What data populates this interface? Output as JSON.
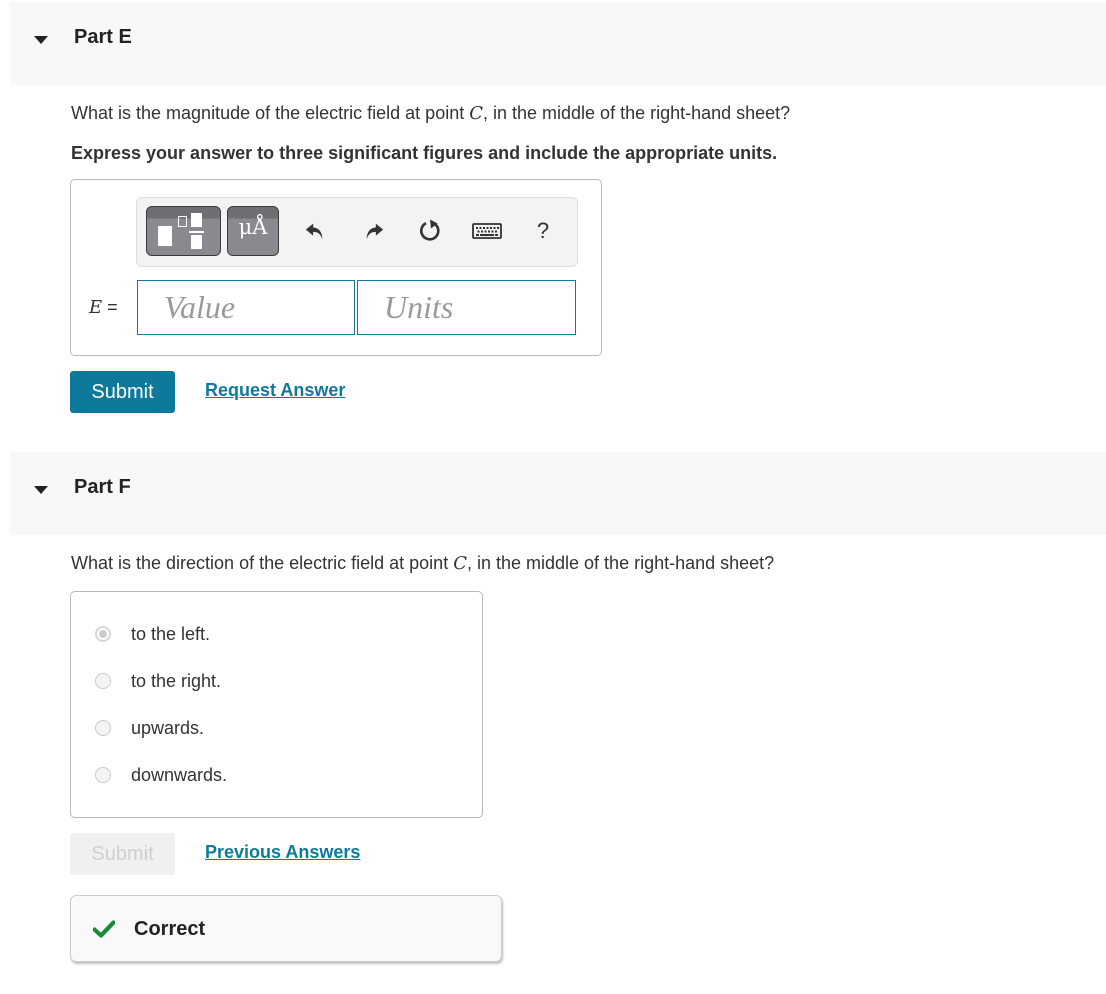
{
  "colors": {
    "accent": "#0d7a9b",
    "header_bg": "#f8f8f8",
    "correct_green": "#1a8a3a"
  },
  "part_e": {
    "title": "Part E",
    "question_before": "What is the magnitude of the electric field at point ",
    "question_var": "C",
    "question_after": ", in the middle of the right-hand sheet?",
    "instruction": "Express your answer to three significant figures and include the appropriate units.",
    "toolbar": {
      "templates_icon": "templates-icon",
      "units_label": "μÅ",
      "undo_icon": "undo-icon",
      "redo_icon": "redo-icon",
      "reset_icon": "reset-icon",
      "keyboard_icon": "keyboard-icon",
      "help_label": "?"
    },
    "equation_var": "E",
    "equation_sign": " =",
    "value_field": {
      "value": "",
      "placeholder": "Value"
    },
    "units_field": {
      "value": "",
      "placeholder": "Units"
    },
    "submit_label": "Submit",
    "request_answer_label": "Request Answer"
  },
  "part_f": {
    "title": "Part F",
    "question_before": "What is the direction of the electric field at point ",
    "question_var": "C",
    "question_after": ", in the middle of the right-hand sheet?",
    "options": [
      {
        "label": "to the left.",
        "selected": true
      },
      {
        "label": "to the right.",
        "selected": false
      },
      {
        "label": "upwards.",
        "selected": false
      },
      {
        "label": "downwards.",
        "selected": false
      }
    ],
    "submit_label": "Submit",
    "submit_disabled": true,
    "previous_answers_label": "Previous Answers",
    "feedback": {
      "icon": "checkmark-icon",
      "text": "Correct"
    }
  }
}
